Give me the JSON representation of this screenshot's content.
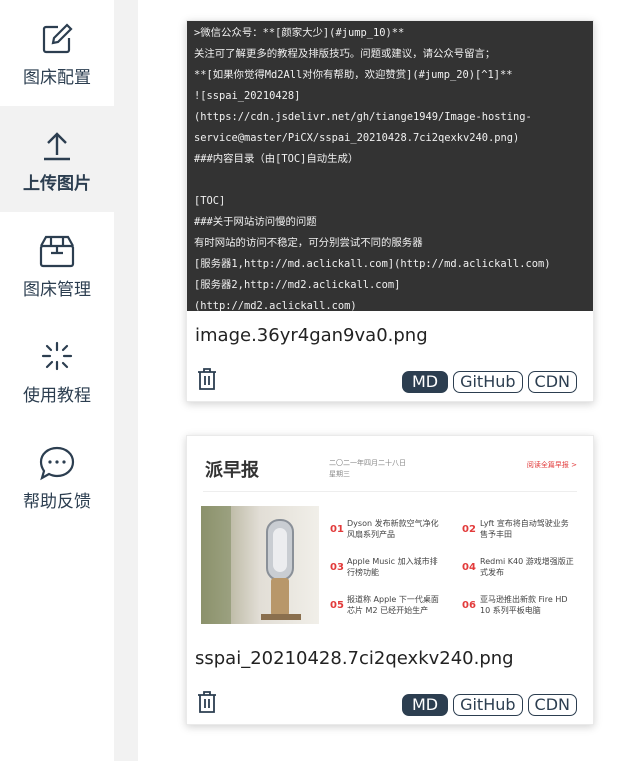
{
  "sidebar": {
    "items": [
      {
        "label": "图床配置",
        "icon": "edit-icon"
      },
      {
        "label": "上传图片",
        "icon": "upload-icon"
      },
      {
        "label": "图床管理",
        "icon": "box-icon"
      },
      {
        "label": "使用教程",
        "icon": "sparkle-icon"
      },
      {
        "label": "帮助反馈",
        "icon": "chat-icon"
      }
    ]
  },
  "cards": [
    {
      "filename": "image.36yr4gan9va0.png",
      "code_lines": [
        ">微信公众号：**[颜家大少](#jump_10)**",
        "关注可了解更多的教程及排版技巧。问题或建议，请公众号留言；",
        "**[如果你觉得Md2All对你有帮助，欢迎赞赏](#jump_20)[^1]**",
        "![sspai_20210428]",
        "(https://cdn.jsdelivr.net/gh/tiange1949/Image-hosting-",
        "service@master/PiCX/sspai_20210428.7ci2qexkv240.png)",
        "###内容目录（由[TOC]自动生成）",
        "",
        "[TOC]",
        "###关于网站访问慢的问题",
        "有时网站的访问不稳定，可分别尝试不同的服务器",
        "[服务器1,http://md.aclickall.com](http://md.aclickall.com)",
        "[服务器2,http://md2.aclickall.com]",
        "(http://md2.aclickall.com)"
      ],
      "buttons": {
        "md": "MD",
        "github": "GitHub",
        "cdn": "CDN"
      }
    },
    {
      "filename": "sspai_20210428.7ci2qexkv240.png",
      "news": {
        "title": "派早报",
        "date_line1": "二〇二一年四月二十八日",
        "date_line2": "星期三",
        "link": "阅读全篇早报 >",
        "items": [
          {
            "num": "01",
            "text": "Dyson 发布新款空气净化风扇系列产品"
          },
          {
            "num": "02",
            "text": "Lyft 宣布将自动驾驶业务售予丰田"
          },
          {
            "num": "03",
            "text": "Apple Music 加入城市排行榜功能"
          },
          {
            "num": "04",
            "text": "Redmi K40 游戏增强版正式发布"
          },
          {
            "num": "05",
            "text": "报道称 Apple 下一代桌面芯片 M2 已经开始生产"
          },
          {
            "num": "06",
            "text": "亚马逊推出新款 Fire HD 10 系列平板电脑"
          }
        ]
      },
      "buttons": {
        "md": "MD",
        "github": "GitHub",
        "cdn": "CDN"
      }
    }
  ],
  "colors": {
    "primary": "#2c3e50",
    "active_bg": "#f2f2f2",
    "code_bg": "#333333",
    "accent_red": "#e23b3b"
  }
}
